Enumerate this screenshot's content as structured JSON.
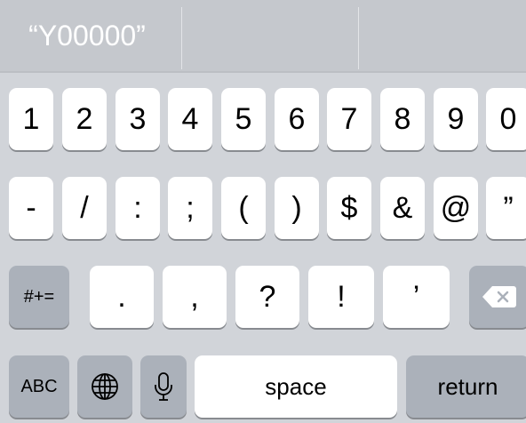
{
  "suggestions": [
    "“Y00000”",
    "",
    ""
  ],
  "rows": {
    "row1": [
      "1",
      "2",
      "3",
      "4",
      "5",
      "6",
      "7",
      "8",
      "9",
      "0"
    ],
    "row2": [
      "-",
      "/",
      ":",
      ";",
      "(",
      ")",
      "$",
      "&",
      "@",
      "”"
    ],
    "row3": [
      ".",
      ",",
      "?",
      "!",
      "’"
    ]
  },
  "keys": {
    "symbols_toggle": "#+=",
    "abc": "ABC",
    "space": "space",
    "return": "return"
  },
  "icons": {
    "globe": "globe-icon",
    "mic": "microphone-icon",
    "delete": "backspace-icon"
  },
  "colors": {
    "keyboard_bg": "#d1d4d9",
    "suggestion_bg": "#c5c8cd",
    "key_light": "#ffffff",
    "key_dark": "#abb1ba"
  }
}
